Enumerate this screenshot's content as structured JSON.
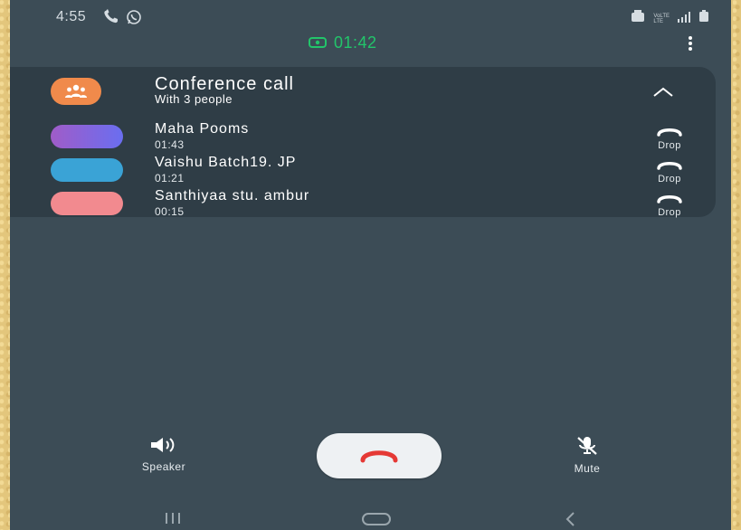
{
  "status_bar": {
    "time": "4:55",
    "left_icons": [
      "phone-icon",
      "whatsapp-icon"
    ],
    "right_icons": [
      "alarm-icon",
      "volte-lte-icon",
      "signal-icon",
      "battery-icon"
    ],
    "lte_line1": "VoLTE",
    "lte_line2": "LTE"
  },
  "call": {
    "timer": "01:42",
    "timer_color": "#22c56a",
    "timer_icon": "video-call-icon"
  },
  "conference": {
    "title": "Conference call",
    "subtitle": "With 3 people",
    "avatar_color": "#f08a4b",
    "participants": [
      {
        "name": "Maha Pooms",
        "duration": "01:43",
        "drop_label": "Drop",
        "avatar_color": "#7c5fe0"
      },
      {
        "name": "Vaishu Batch19. JP",
        "duration": "01:21",
        "drop_label": "Drop",
        "avatar_color": "#3aa3d6"
      },
      {
        "name": "Santhiyaa stu. ambur",
        "duration": "00:15",
        "drop_label": "Drop",
        "avatar_color": "#f28a8f"
      }
    ]
  },
  "controls": {
    "speaker_label": "Speaker",
    "mute_label": "Mute",
    "end_call_color": "#e53935"
  },
  "colors": {
    "screen_bg": "#3c4c56",
    "card_bg": "#2f3d46",
    "outer_bg": "#e3c67c"
  }
}
